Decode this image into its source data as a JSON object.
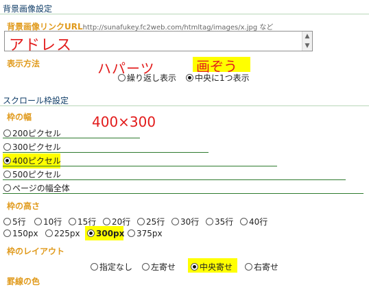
{
  "header": {
    "title": "背景画像設定"
  },
  "background_image": {
    "url_label": "背景画像リンクURL",
    "url_example": "http://sunafukey.fc2web.com/htmltag/images/x.jpg など",
    "url_value": "アドレス",
    "display_label": "表示方法",
    "display_options": [
      "繰り返し表示",
      "中央に1つ表示"
    ],
    "display_selected_index": 1,
    "annotation_left": "ハパーツ",
    "annotation_right": "画ぞう"
  },
  "scroll_frame": {
    "title": "スクロール枠設定",
    "width_label": "枠の幅",
    "width_options": [
      "200ピクセル",
      "300ピクセル",
      "400ピクセル",
      "500ピクセル",
      "ページの幅全体"
    ],
    "width_selected_index": 2,
    "size_annotation": "400×300",
    "height_label": "枠の高さ",
    "height_options_row1": [
      "5行",
      "10行",
      "15行",
      "20行",
      "25行",
      "30行",
      "35行",
      "40行"
    ],
    "height_options_row2": [
      "150px",
      "225px",
      "300px",
      "375px"
    ],
    "height_selected": "300px",
    "layout_label": "枠のレイアウト",
    "layout_options": [
      "指定なし",
      "左寄せ",
      "中央寄せ",
      "右寄せ"
    ],
    "layout_selected_index": 2,
    "next_label_partial": "罫線の色"
  },
  "colors": {
    "accent_gold": "#e09a1c",
    "highlight": "#ffff00",
    "annotation_red": "#e21b1b",
    "rule_green": "#2d7a2d"
  }
}
